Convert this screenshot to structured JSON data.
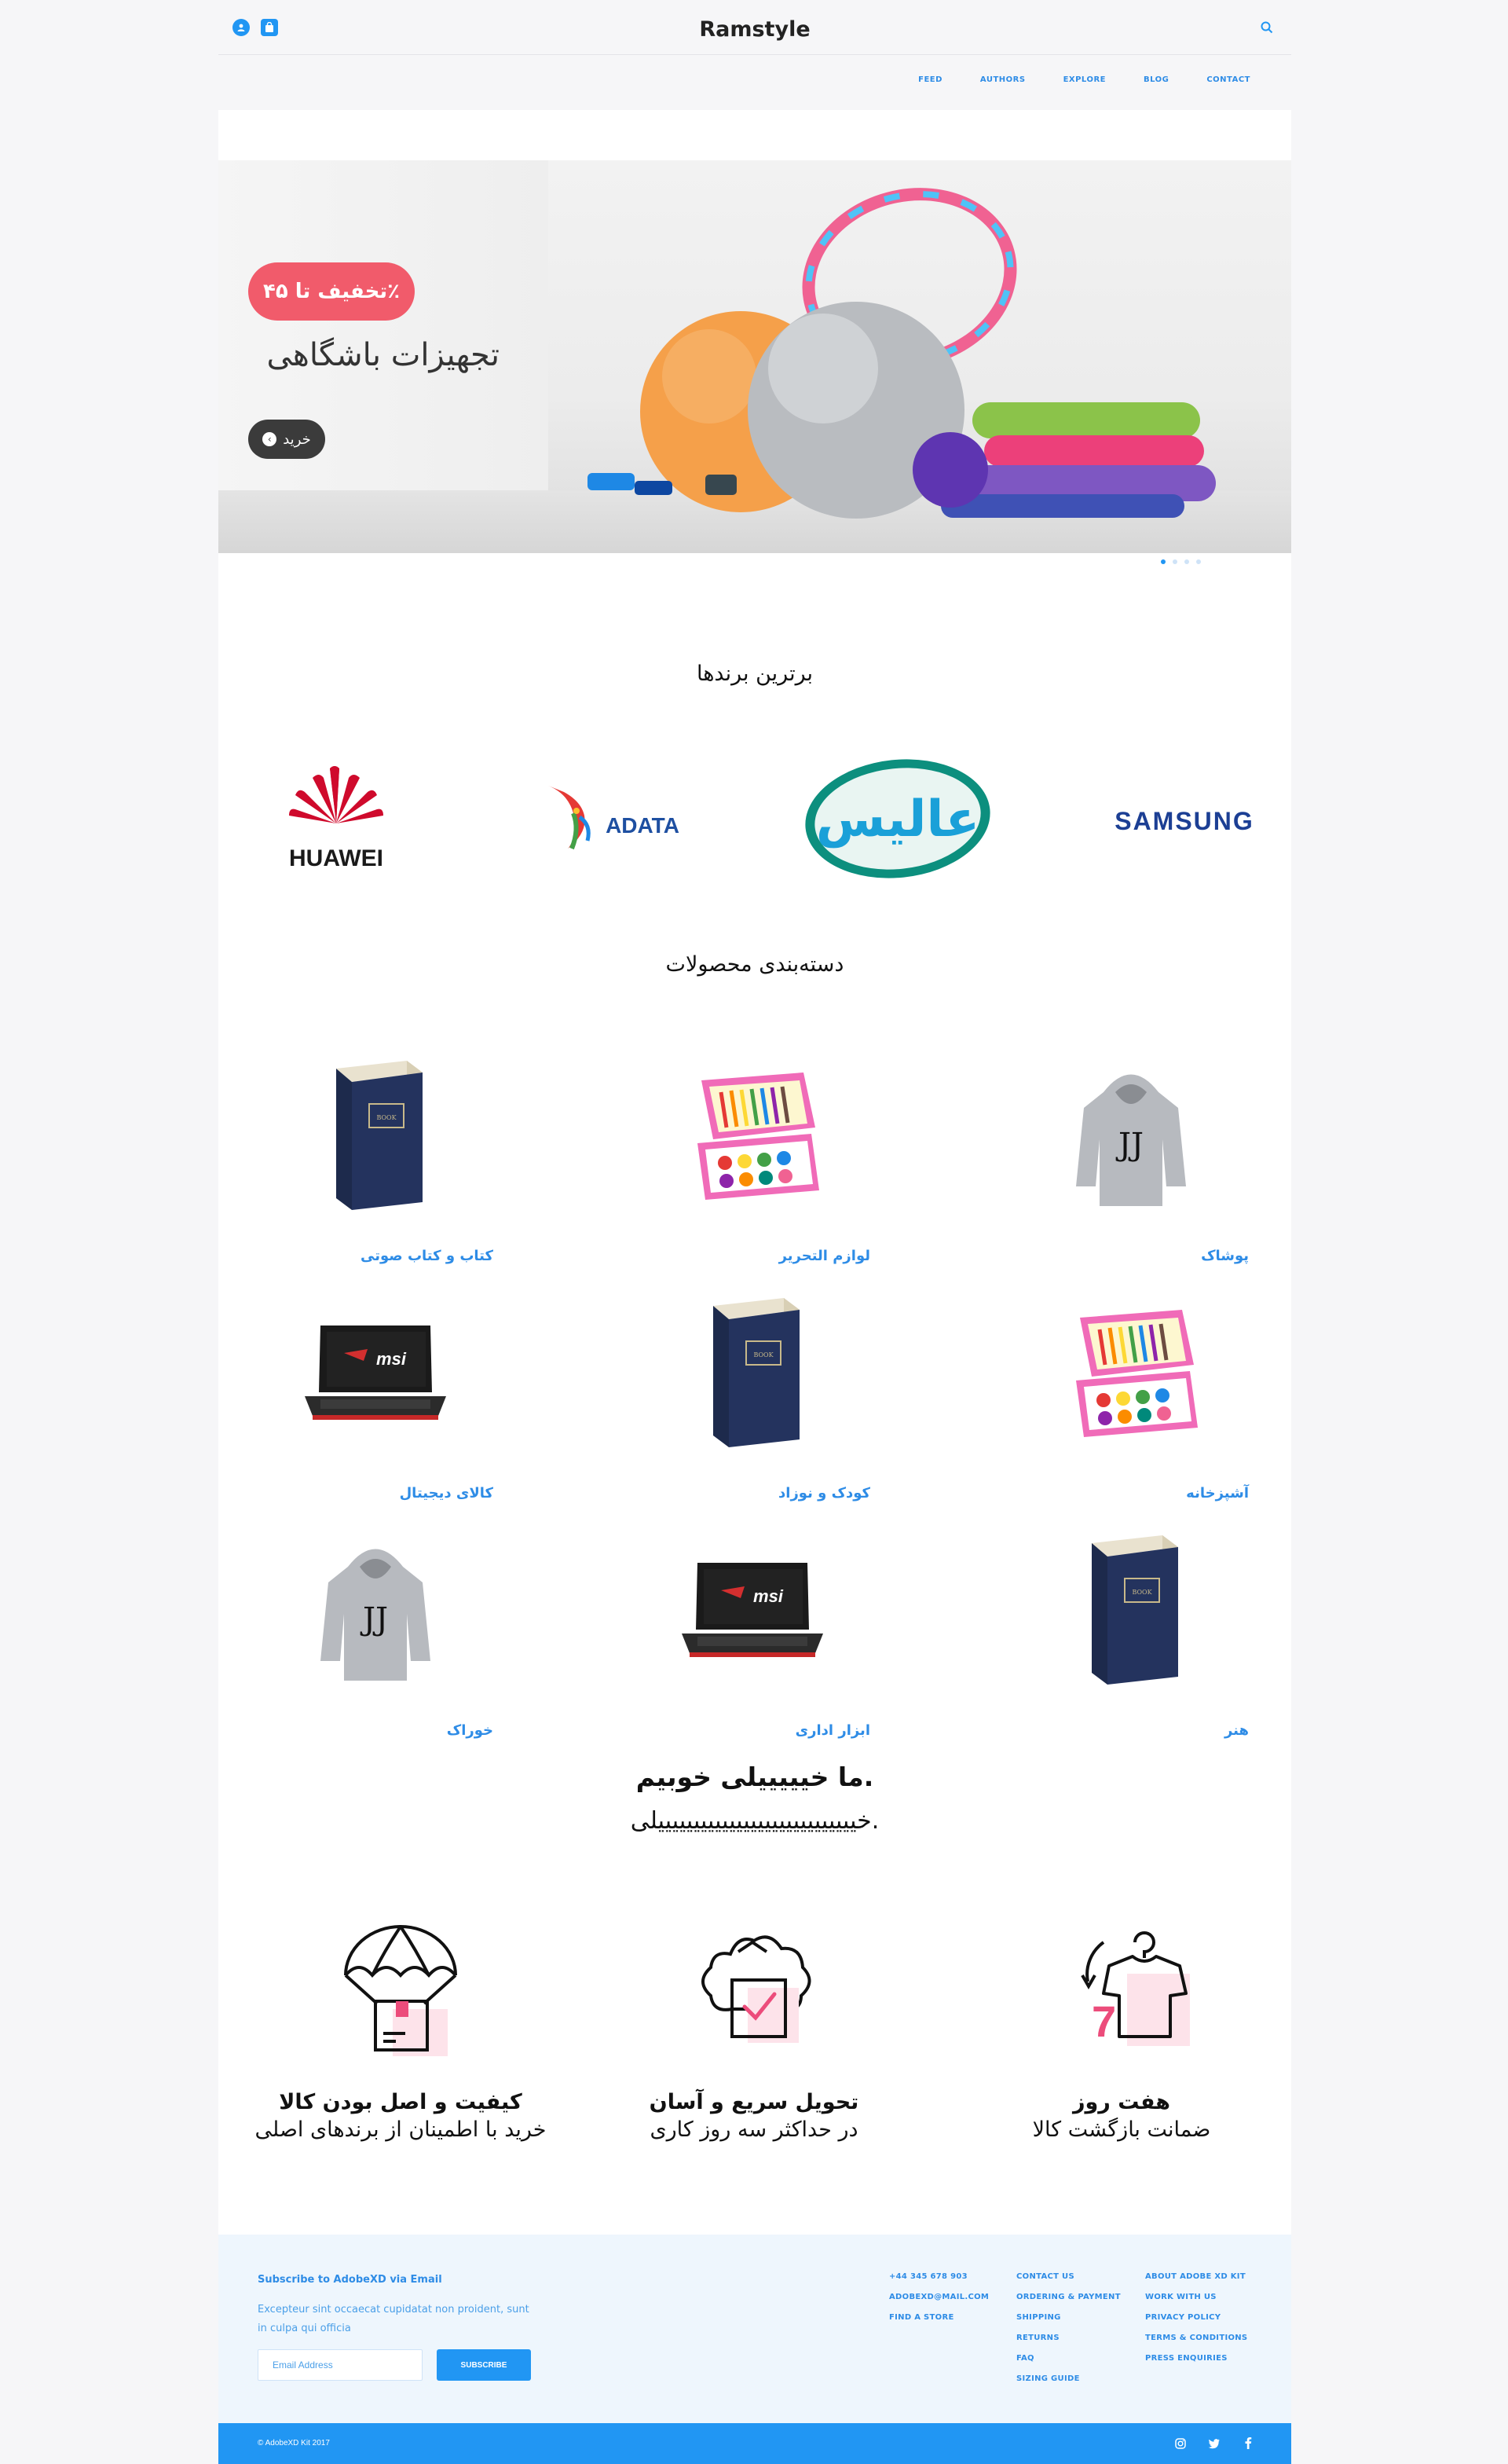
{
  "header": {
    "brand": "Ramstyle",
    "nav": [
      "FEED",
      "AUTHORS",
      "EXPLORE",
      "BLOG",
      "CONTACT"
    ]
  },
  "hero": {
    "discount": "تخفیف تا ۴۵٪",
    "title": "تجهیزات باشگاهی",
    "buy_label": "خرید",
    "slides": 4,
    "active_slide": 1
  },
  "brands": {
    "title": "برترین برندها",
    "items": [
      "HUAWEI",
      "ADATA",
      "عالیس",
      "SAMSUNG"
    ]
  },
  "categories": {
    "title": "دسته‌بندی محصولات",
    "items": [
      {
        "label": "پوشاک",
        "image": "hoodie"
      },
      {
        "label": "لوازم التحریر",
        "image": "art-set"
      },
      {
        "label": "کتاب و کتاب صوتی",
        "image": "book"
      },
      {
        "label": "آشپزخانه",
        "image": "art-set"
      },
      {
        "label": "کودک و نوزاد",
        "image": "book"
      },
      {
        "label": "کالای دیجیتال",
        "image": "laptop"
      },
      {
        "label": "هنر",
        "image": "book"
      },
      {
        "label": "ابزار اداری",
        "image": "laptop"
      },
      {
        "label": "خوراک",
        "image": "hoodie"
      }
    ]
  },
  "about": {
    "headline": ".ما خیییییلی خوبیم",
    "subline": ".خییییییییییییییییییییییییییییلی"
  },
  "features": [
    {
      "title": "هفت روز",
      "subtitle": "ضمانت بازگشت کالا",
      "icon": "return-7-days-icon",
      "badge": "7"
    },
    {
      "title": "تحویل سریع و آسان",
      "subtitle": "در حداکثر سه روز کاری",
      "icon": "fast-delivery-icon"
    },
    {
      "title": "کیفیت و اصل بودن کالا",
      "subtitle": "خرید با اطمینان از برندهای اصلی",
      "icon": "quality-parachute-icon"
    }
  ],
  "footer": {
    "subscribe_title": "Subscribe to AdobeXD via Email",
    "subscribe_text": "Excepteur sint occaecat cupidatat non proident, sunt in culpa qui officia",
    "email_placeholder": "Email Address",
    "subscribe_button": "SUBSCRIBE",
    "contact": [
      "+44 345 678 903",
      "ADOBEXD@MAIL.COM",
      "FIND A STORE"
    ],
    "help": [
      "CONTACT US",
      "ORDERING & PAYMENT",
      "SHIPPING",
      "RETURNS",
      "FAQ",
      "SIZING GUIDE"
    ],
    "company": [
      "ABOUT ADOBE XD KIT",
      "WORK WITH US",
      "PRIVACY POLICY",
      "TERMS & CONDITIONS",
      "PRESS ENQUIRIES"
    ],
    "copyright": "© AdobeXD Kit 2017"
  },
  "colors": {
    "accent": "#2196f3",
    "pink": "#f15b6b",
    "footer_bg": "#eef6fd"
  }
}
